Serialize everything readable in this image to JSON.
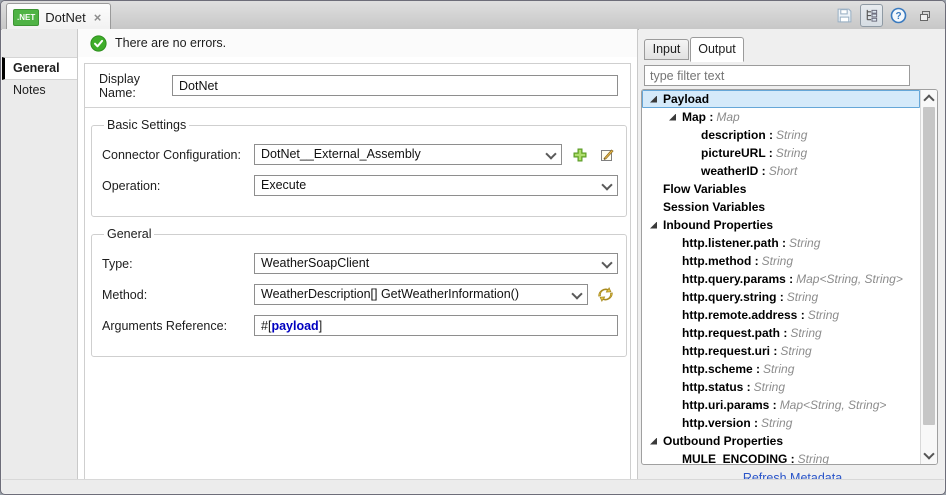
{
  "window": {
    "tab": {
      "label": "DotNet",
      "badge": ".NET",
      "close": "×"
    },
    "toolbar": {
      "save": "save",
      "link_with_editor": "link-with-editor",
      "help": "?",
      "restore": "restore"
    }
  },
  "sidebar": {
    "items": [
      {
        "label": "General",
        "selected": true
      },
      {
        "label": "Notes",
        "selected": false
      }
    ]
  },
  "form": {
    "status": "There are no errors.",
    "display_name": {
      "label": "Display Name:",
      "value": "DotNet"
    },
    "basic_settings": {
      "title": "Basic Settings",
      "connector_configuration": {
        "label": "Connector Configuration:",
        "value": "DotNet__External_Assembly"
      },
      "operation": {
        "label": "Operation:",
        "value": "Execute"
      }
    },
    "general": {
      "title": "General",
      "type": {
        "label": "Type:",
        "value": "WeatherSoapClient"
      },
      "method": {
        "label": "Method:",
        "value": "WeatherDescription[] GetWeatherInformation()"
      },
      "arguments_reference": {
        "label": "Arguments Reference:",
        "prefix": "#[",
        "value": "payload",
        "suffix": "]"
      }
    }
  },
  "metadata_panel": {
    "tabs": [
      {
        "label": "Input",
        "active": false
      },
      {
        "label": "Output",
        "active": true
      }
    ],
    "filter_placeholder": "type filter text",
    "tree": [
      {
        "label": "Payload",
        "type": "",
        "level": 0,
        "expanded": true,
        "selected": true
      },
      {
        "label": "Map",
        "type": "Map",
        "level": 1,
        "expanded": true
      },
      {
        "label": "description",
        "type": "String",
        "level": 2
      },
      {
        "label": "pictureURL",
        "type": "String",
        "level": 2
      },
      {
        "label": "weatherID",
        "type": "Short",
        "level": 2
      },
      {
        "label": "Flow Variables",
        "type": "",
        "level": 0
      },
      {
        "label": "Session Variables",
        "type": "",
        "level": 0
      },
      {
        "label": "Inbound Properties",
        "type": "",
        "level": 0,
        "expanded": true
      },
      {
        "label": "http.listener.path",
        "type": "String",
        "level": 1
      },
      {
        "label": "http.method",
        "type": "String",
        "level": 1
      },
      {
        "label": "http.query.params",
        "type": "Map<String, String>",
        "level": 1
      },
      {
        "label": "http.query.string",
        "type": "String",
        "level": 1
      },
      {
        "label": "http.remote.address",
        "type": "String",
        "level": 1
      },
      {
        "label": "http.request.path",
        "type": "String",
        "level": 1
      },
      {
        "label": "http.request.uri",
        "type": "String",
        "level": 1
      },
      {
        "label": "http.scheme",
        "type": "String",
        "level": 1
      },
      {
        "label": "http.status",
        "type": "String",
        "level": 1
      },
      {
        "label": "http.uri.params",
        "type": "Map<String, String>",
        "level": 1
      },
      {
        "label": "http.version",
        "type": "String",
        "level": 1
      },
      {
        "label": "Outbound Properties",
        "type": "",
        "level": 0,
        "expanded": true
      },
      {
        "label": "MULE_ENCODING",
        "type": "String",
        "level": 1
      }
    ],
    "refresh_link": "Refresh Metadata"
  },
  "colors": {
    "selection_fill": "#d5eafa",
    "selection_border": "#66a7d8",
    "link_blue": "#2a55c8",
    "dotnet_green": "#4fb345",
    "check_green": "#3fae2a",
    "expression_blue": "#0000c0",
    "type_gray": "#8c8c8c"
  }
}
